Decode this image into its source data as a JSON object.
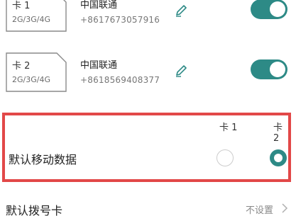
{
  "sim_cards": [
    {
      "name": "卡 1",
      "network": "2G/3G/4G",
      "carrier": "中国联通",
      "phone": "+8617673057916",
      "enabled": true,
      "edit_icon": "edit-pencil-icon"
    },
    {
      "name": "卡 2",
      "network": "2G/3G/4G",
      "carrier": "中国联通",
      "phone": "+8618569408377",
      "enabled": true,
      "edit_icon": "edit-pencil-icon"
    }
  ],
  "default_data": {
    "label": "默认移动数据",
    "columns": [
      "卡 1",
      "卡 2"
    ],
    "selected": "卡 2"
  },
  "default_dial": {
    "label": "默认拨号卡",
    "value": "不设置"
  },
  "colors": {
    "accent": "#2d8a86",
    "highlight_border": "#e24848"
  }
}
